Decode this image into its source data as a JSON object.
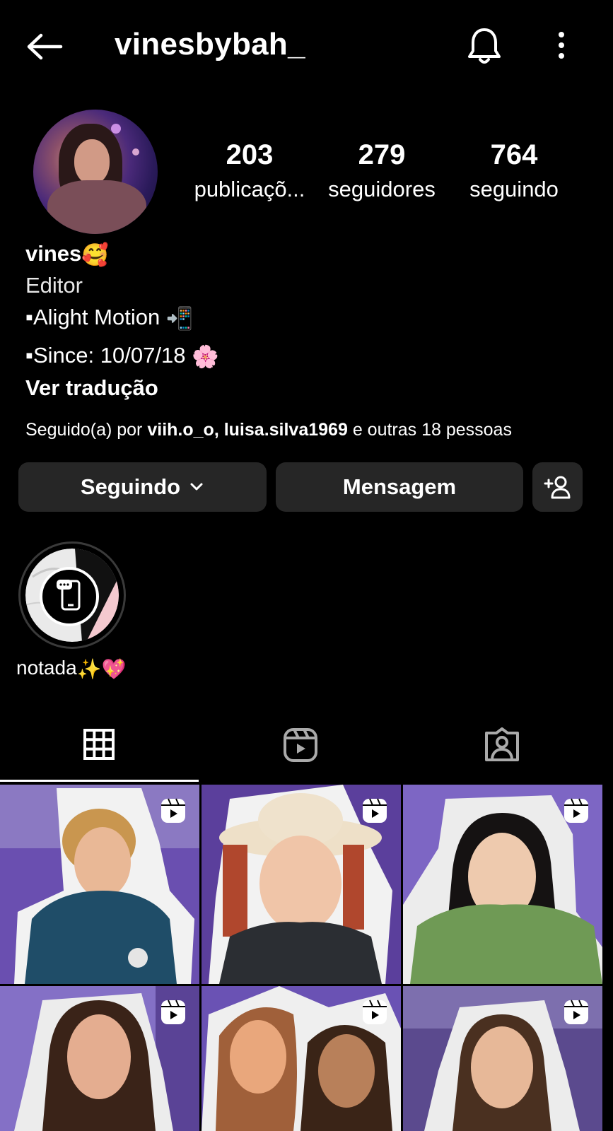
{
  "header": {
    "username": "vinesbybah_",
    "back_icon": "arrow-left-icon",
    "bell_icon": "bell-icon",
    "menu_icon": "more-vertical-icon"
  },
  "stats": [
    {
      "value": "203",
      "label": "publicaçõ..."
    },
    {
      "value": "279",
      "label": "seguidores"
    },
    {
      "value": "764",
      "label": "seguindo"
    }
  ],
  "bio": {
    "name": "vines",
    "name_emoji": "🥰",
    "category": "Editor",
    "line1": "▪Alight Motion",
    "line1_emoji": "📲",
    "line2": "▪Since: 10/07/18",
    "line2_emoji": "🌸",
    "translate": "Ver tradução"
  },
  "followed_by": {
    "prefix": "Seguido(a) por",
    "user1": "viih.o_o",
    "sep": ",",
    "user2": "luisa.silva1969",
    "suffix": "e outras 18 pessoas"
  },
  "actions": {
    "following": "Seguindo",
    "message": "Mensagem",
    "add_icon": "add-person-icon"
  },
  "highlight": {
    "label": "notada",
    "label_emoji": "✨💖"
  },
  "tabs": [
    {
      "name": "grid",
      "icon": "grid-icon",
      "active": true
    },
    {
      "name": "reels",
      "icon": "reels-icon",
      "active": false
    },
    {
      "name": "tagged",
      "icon": "tagged-icon",
      "active": false
    }
  ],
  "colors": {
    "background": "#000000",
    "button": "#262626",
    "accent_purple": "#7b5cc4"
  }
}
